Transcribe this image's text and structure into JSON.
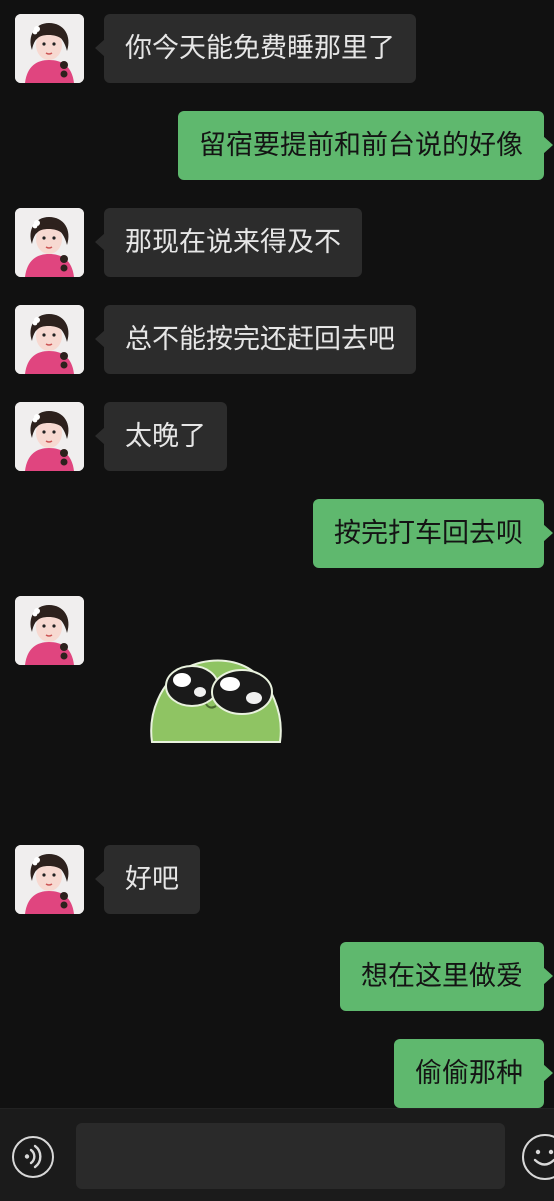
{
  "messages": [
    {
      "from": "them",
      "text": "你今天能免费睡那里了"
    },
    {
      "from": "me",
      "text": "留宿要提前和前台说的好像"
    },
    {
      "from": "them",
      "text": "那现在说来得及不"
    },
    {
      "from": "them",
      "text": "总不能按完还赶回去吧"
    },
    {
      "from": "them",
      "text": "太晚了"
    },
    {
      "from": "me",
      "text": "按完打车回去呗"
    },
    {
      "from": "them",
      "type": "sticker",
      "sticker_icon": "green-frog-sticker-icon"
    },
    {
      "from": "them",
      "text": "好吧"
    },
    {
      "from": "me",
      "text": "想在这里做爱"
    },
    {
      "from": "me",
      "text": "偷偷那种"
    }
  ],
  "colors": {
    "background": "#111111",
    "incoming_bubble": "#2c2c2c",
    "outgoing_bubble": "#5fb86e",
    "input_bar": "#1b1b1b"
  },
  "input_bar": {
    "voice_icon": "voice-input-icon",
    "text_value": "",
    "emoji_icon": "emoji-icon"
  }
}
